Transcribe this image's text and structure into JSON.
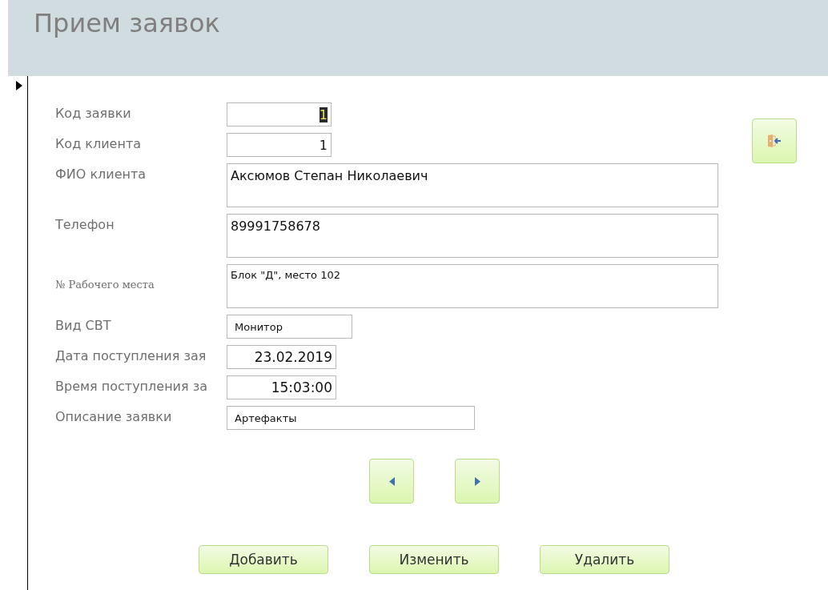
{
  "form": {
    "title": "Прием заявок"
  },
  "fields": [
    {
      "kind": "id",
      "label": "Код заявки",
      "value": "1",
      "text_selected": true
    },
    {
      "kind": "id",
      "label": "Код клиента",
      "value": "1",
      "text_selected": false
    },
    {
      "kind": "memo",
      "label": "ФИО клиента",
      "value": "Аксюмов Степан Николаевич",
      "text_selected": false
    },
    {
      "kind": "memo",
      "label": "Телефон",
      "value": "89991758678",
      "text_selected": false
    },
    {
      "kind": "note",
      "label": "№ Рабочего места",
      "value": "Блок \"Д\", место 102",
      "text_selected": false
    },
    {
      "kind": "short",
      "label": "Вид СВТ",
      "value": "Монитор",
      "text_selected": false
    },
    {
      "kind": "datetime",
      "label": "Дата поступления зая",
      "value": "23.02.2019",
      "text_selected": false
    },
    {
      "kind": "datetime",
      "label": "Время поступления за",
      "value": "15:03:00",
      "text_selected": false
    },
    {
      "kind": "text",
      "label": "Описание заявки",
      "value": "Артефакты",
      "text_selected": false
    }
  ],
  "actions": [
    "Добавить",
    "Изменить",
    "Удалить"
  ]
}
